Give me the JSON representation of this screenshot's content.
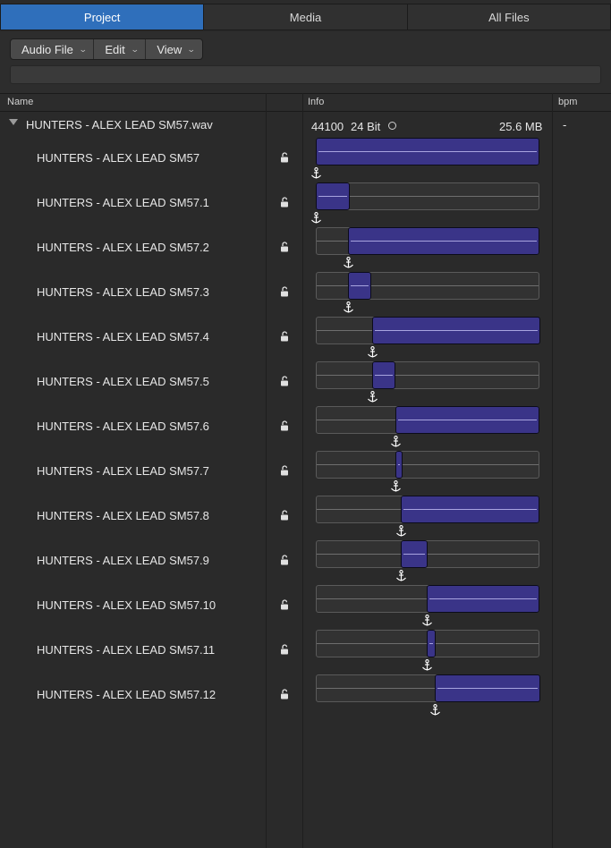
{
  "tabs": [
    {
      "label": "Project",
      "active": true
    },
    {
      "label": "Media",
      "active": false
    },
    {
      "label": "All Files",
      "active": false
    }
  ],
  "toolbar": {
    "menus": [
      "Audio File",
      "Edit",
      "View"
    ],
    "search_value": ""
  },
  "columns": {
    "name": "Name",
    "info": "Info",
    "bpm": "bpm"
  },
  "file": {
    "name": "HUNTERS  - ALEX LEAD SM57.wav",
    "sample_rate": "44100",
    "bit_depth": "24 Bit",
    "size": "25.6 MB",
    "bpm": "-"
  },
  "regions": [
    {
      "name": "HUNTERS  - ALEX LEAD SM57",
      "start": 0.0,
      "end": 1.0
    },
    {
      "name": "HUNTERS  - ALEX LEAD SM57.1",
      "start": 0.0,
      "end": 0.15
    },
    {
      "name": "HUNTERS  - ALEX LEAD SM57.2",
      "start": 0.145,
      "end": 1.0
    },
    {
      "name": "HUNTERS  - ALEX LEAD SM57.3",
      "start": 0.145,
      "end": 0.25
    },
    {
      "name": "HUNTERS  - ALEX LEAD SM57.4",
      "start": 0.25,
      "end": 1.0
    },
    {
      "name": "HUNTERS  - ALEX LEAD SM57.5",
      "start": 0.25,
      "end": 0.355
    },
    {
      "name": "HUNTERS  - ALEX LEAD SM57.6",
      "start": 0.355,
      "end": 1.0
    },
    {
      "name": "HUNTERS  - ALEX LEAD SM57.7",
      "start": 0.355,
      "end": 0.385
    },
    {
      "name": "HUNTERS  - ALEX LEAD SM57.8",
      "start": 0.38,
      "end": 1.0
    },
    {
      "name": "HUNTERS  - ALEX LEAD SM57.9",
      "start": 0.38,
      "end": 0.5
    },
    {
      "name": "HUNTERS  - ALEX LEAD SM57.10",
      "start": 0.495,
      "end": 1.0
    },
    {
      "name": "HUNTERS  - ALEX LEAD SM57.11",
      "start": 0.495,
      "end": 0.535
    },
    {
      "name": "HUNTERS  - ALEX LEAD SM57.12",
      "start": 0.53,
      "end": 1.0
    }
  ],
  "colors": {
    "accent": "#2f6fbb",
    "region_fill": "#3a3488"
  }
}
